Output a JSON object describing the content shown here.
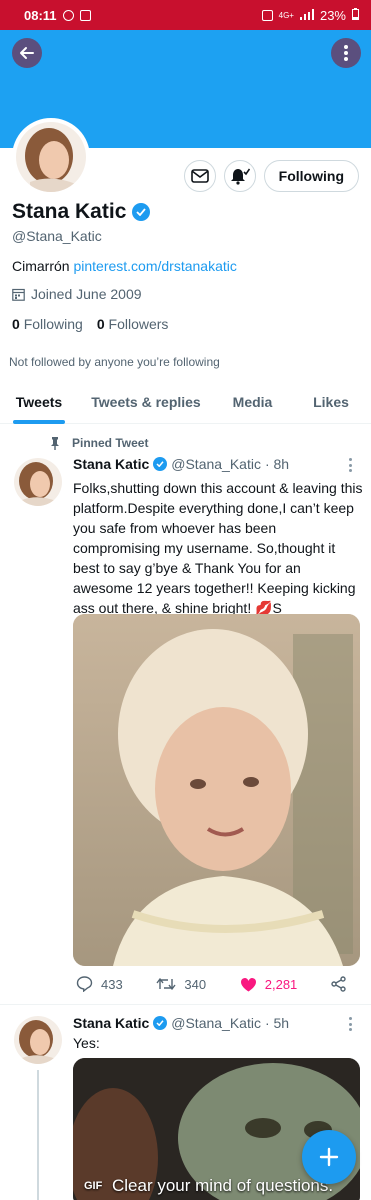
{
  "status_bar": {
    "time": "08:11",
    "battery": "23%",
    "network": "4G+"
  },
  "profile": {
    "name": "Stana Katic",
    "handle": "@Stana_Katic",
    "bio_text": "Cimarrón",
    "bio_link": "pinterest.com/drstanakatic",
    "joined": "Joined June 2009",
    "following_count": "0",
    "following_label": "Following",
    "followers_count": "0",
    "followers_label": "Followers",
    "not_followed_text": "Not followed by anyone you’re following",
    "following_button": "Following"
  },
  "tabs": [
    {
      "label": "Tweets",
      "active": true
    },
    {
      "label": "Tweets & replies",
      "active": false
    },
    {
      "label": "Media",
      "active": false
    },
    {
      "label": "Likes",
      "active": false
    }
  ],
  "tweets": [
    {
      "pinned_label": "Pinned Tweet",
      "name": "Stana Katic",
      "handle": "@Stana_Katic",
      "time": "· 8h",
      "text": "Folks,shutting down this account & leaving this platform.Despite everything done,I can’t keep you safe from whoever has been compromising my username. So,thought it best to say g’bye & Thank You for an awesome 12 years together!! Keeping kicking ass out there, & shine bright!",
      "text_emoji": "💋",
      "text_signoff": "S",
      "replies": "433",
      "retweets": "340",
      "likes": "2,281"
    },
    {
      "name": "Stana Katic",
      "handle": "@Stana_Katic",
      "time": "· 5h",
      "text": "Yes:",
      "gif_badge": "GIF",
      "gif_caption": "Clear your mind of questions."
    }
  ],
  "colors": {
    "banner": "#1da1f2",
    "accent": "#1d9bf0",
    "status_bar": "#c8102e",
    "like": "#f91880"
  },
  "icons": [
    "back-arrow-icon",
    "more-vertical-icon",
    "mail-icon",
    "bell-icon",
    "calendar-icon",
    "pin-icon",
    "verified-icon",
    "reply-icon",
    "retweet-icon",
    "heart-icon",
    "share-icon",
    "compose-plus-icon"
  ]
}
